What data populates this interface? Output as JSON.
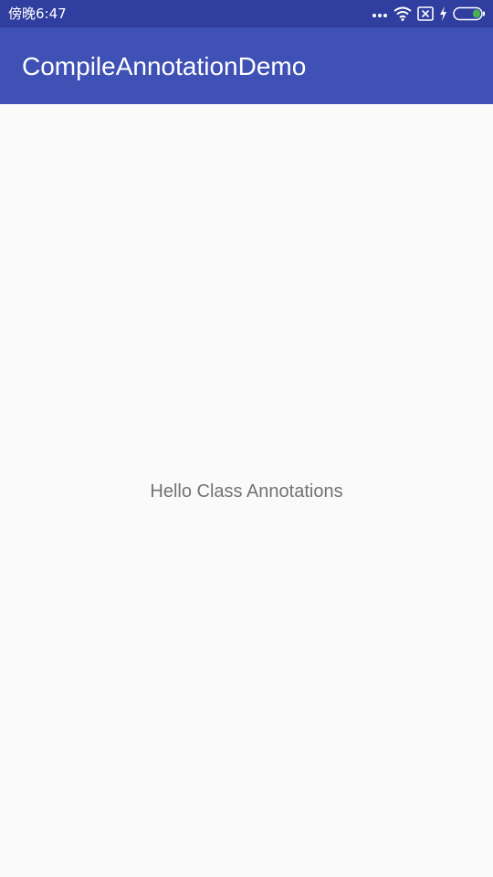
{
  "status_bar": {
    "time": "傍晚6:47",
    "icons": [
      "more-dots-icon",
      "wifi-icon",
      "no-sim-icon",
      "charging-icon",
      "battery-icon"
    ],
    "background_color": "#303f9f",
    "battery_color": "#4caf50"
  },
  "app_bar": {
    "title": "CompileAnnotationDemo",
    "background_color": "#3f51b5"
  },
  "main": {
    "hello_text": "Hello Class Annotations",
    "background_color": "#fafafa"
  }
}
